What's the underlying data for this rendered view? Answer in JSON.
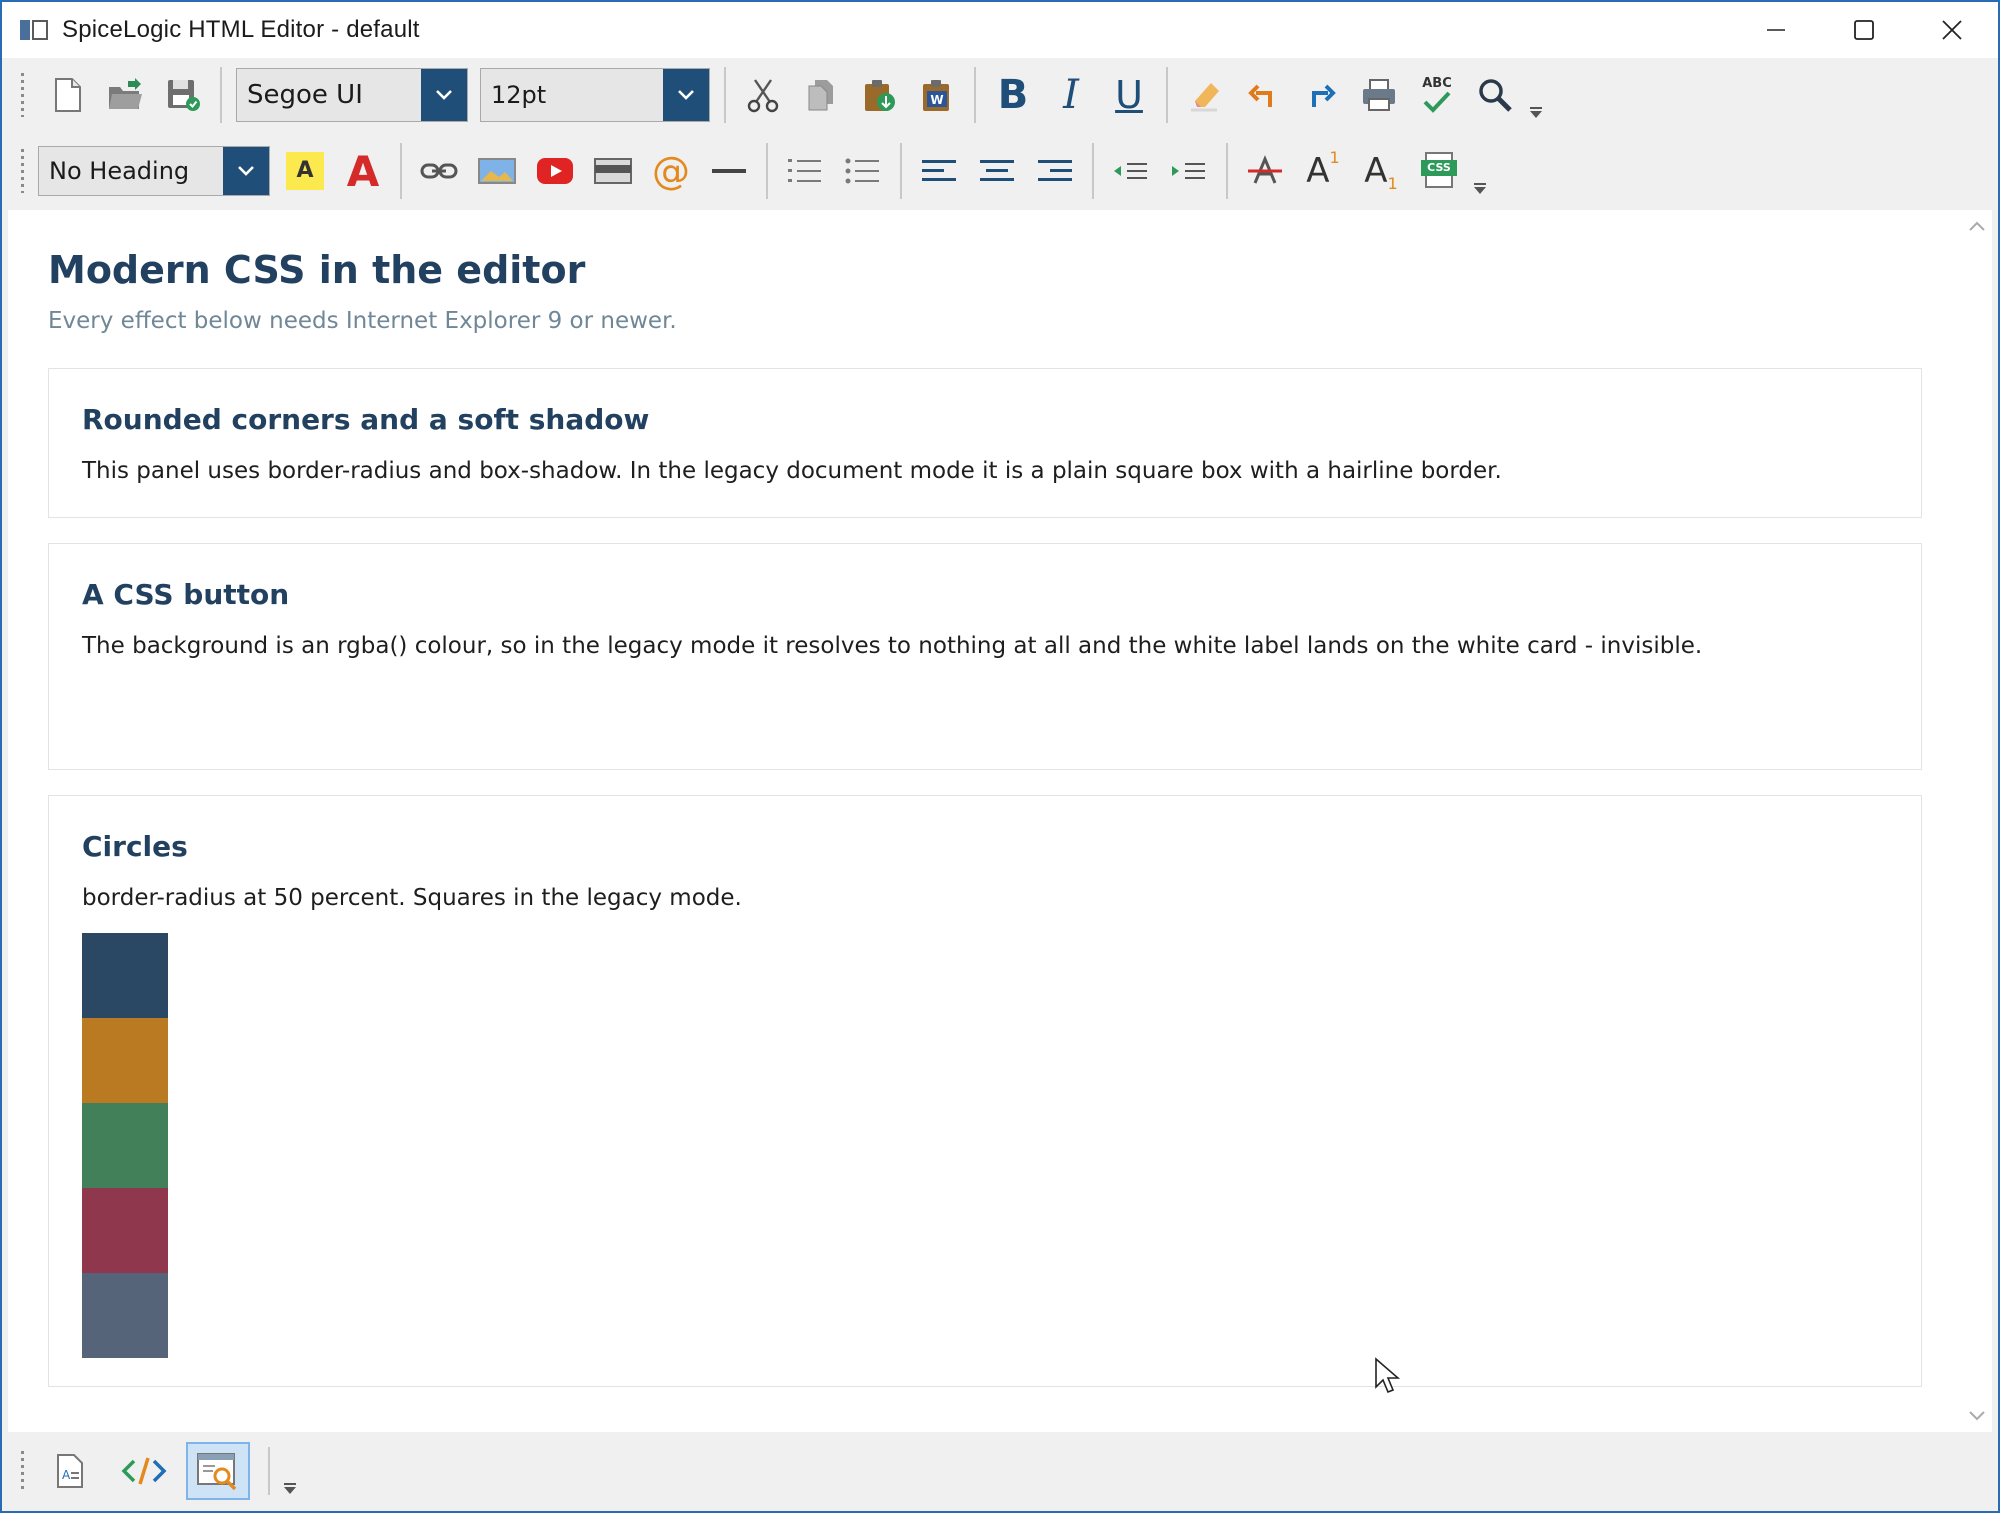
{
  "window": {
    "title": "SpiceLogic HTML Editor  -  default"
  },
  "toolbar1": {
    "font_name": "Segoe UI",
    "font_size": "12pt",
    "buttons": [
      "new-document",
      "open",
      "save",
      "cut",
      "copy",
      "paste",
      "paste-from-word",
      "bold",
      "italic",
      "underline",
      "clear-formatting",
      "undo",
      "redo",
      "print",
      "spell-check",
      "find"
    ],
    "bold_label": "B",
    "italic_label": "I",
    "underline_label": "U",
    "spell_label": "ABC"
  },
  "toolbar2": {
    "heading": "No Heading",
    "highlight_label": "A",
    "font_color_label": "A",
    "email_label": "@",
    "superscript_label": "A",
    "superscript_mark": "1",
    "subscript_label": "A",
    "subscript_mark": "1",
    "css_label": "CSS"
  },
  "document": {
    "title": "Modern CSS in the editor",
    "subtitle": "Every effect below needs Internet Explorer 9 or newer.",
    "cards": [
      {
        "heading": "Rounded corners and a soft shadow",
        "text": "This panel uses border-radius and box-shadow. In the legacy document mode it is a plain square box with a hairline border."
      },
      {
        "heading": "A CSS button",
        "text": "The background is an rgba() colour, so in the legacy mode it resolves to nothing at all and the white label lands on the white card - invisible."
      },
      {
        "heading": "Circles",
        "text": "border-radius at 50 percent. Squares in the legacy mode."
      }
    ],
    "swatch_colors": [
      "#2a4764",
      "#b97a22",
      "#418059",
      "#8f384d",
      "#566479"
    ]
  },
  "colors": {
    "accent": "#1f4e79",
    "heading": "#22405f",
    "subtitle": "#6f8797",
    "window_border": "#2a6bb5"
  },
  "bottombar": {
    "views": [
      "design-view",
      "source-view",
      "preview-view"
    ],
    "active_view": "preview-view"
  }
}
